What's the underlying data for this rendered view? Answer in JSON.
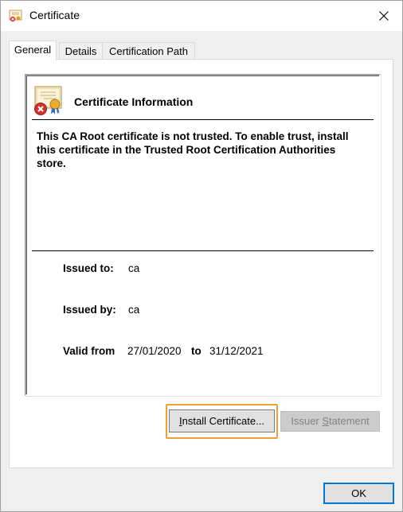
{
  "window": {
    "title": "Certificate"
  },
  "tabs": [
    {
      "label": "General",
      "active": true
    },
    {
      "label": "Details",
      "active": false
    },
    {
      "label": "Certification Path",
      "active": false
    }
  ],
  "info": {
    "title": "Certificate Information",
    "warning": "This CA Root certificate is not trusted. To enable trust, install this certificate in the Trusted Root Certification Authorities store."
  },
  "fields": {
    "issued_to_label": "Issued to:",
    "issued_to_value": "ca",
    "issued_by_label": "Issued by:",
    "issued_by_value": "ca",
    "valid_from_label": "Valid from",
    "valid_from_value": "27/01/2020",
    "to_label": "to",
    "valid_to_value": "31/12/2021"
  },
  "buttons": {
    "install_prefix": "I",
    "install_rest": "nstall Certificate...",
    "issuer_prefix": "Issuer ",
    "issuer_underlined": "S",
    "issuer_rest": "tatement",
    "ok": "OK"
  },
  "icons": {
    "title_icon": "certificate-icon",
    "cert_icon": "certificate-error-icon",
    "close_icon": "close-icon"
  },
  "colors": {
    "focus_ring": "#f0a030",
    "ok_border": "#0078d7",
    "error_badge": "#d0312d"
  }
}
